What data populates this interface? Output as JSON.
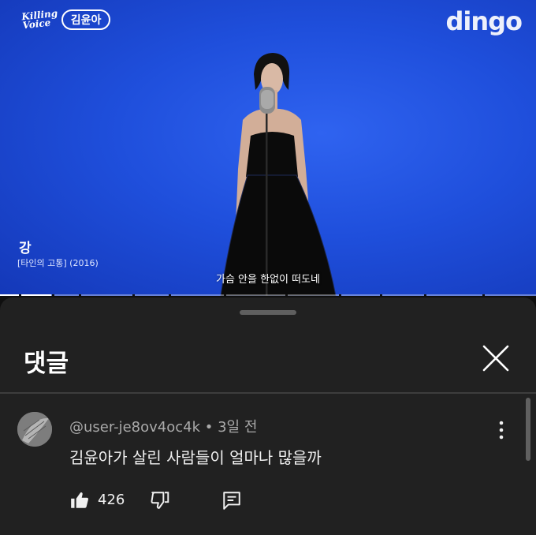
{
  "video": {
    "show_logo_line1": "Killing",
    "show_logo_line2": "Voice",
    "artist_pill": "김윤아",
    "channel_logo": "dingo",
    "song_title": "강",
    "song_subtitle": "[타인의 고통] (2016)",
    "lyric_caption": "가슴 안을 한없이 떠도네",
    "background_color": "#1f4fdc",
    "progress_fraction": 0.095
  },
  "comments_panel": {
    "title": "댓글",
    "close_icon": "close-icon",
    "comments": [
      {
        "user": "@user-je8ov4oc4k",
        "separator": " • ",
        "time": "3일 전",
        "text": "김윤아가 살린 사람들이 얼마나 많을까",
        "likes": "426",
        "icons": [
          "like-icon",
          "dislike-icon",
          "reply-icon",
          "more-vert-icon"
        ]
      }
    ]
  }
}
